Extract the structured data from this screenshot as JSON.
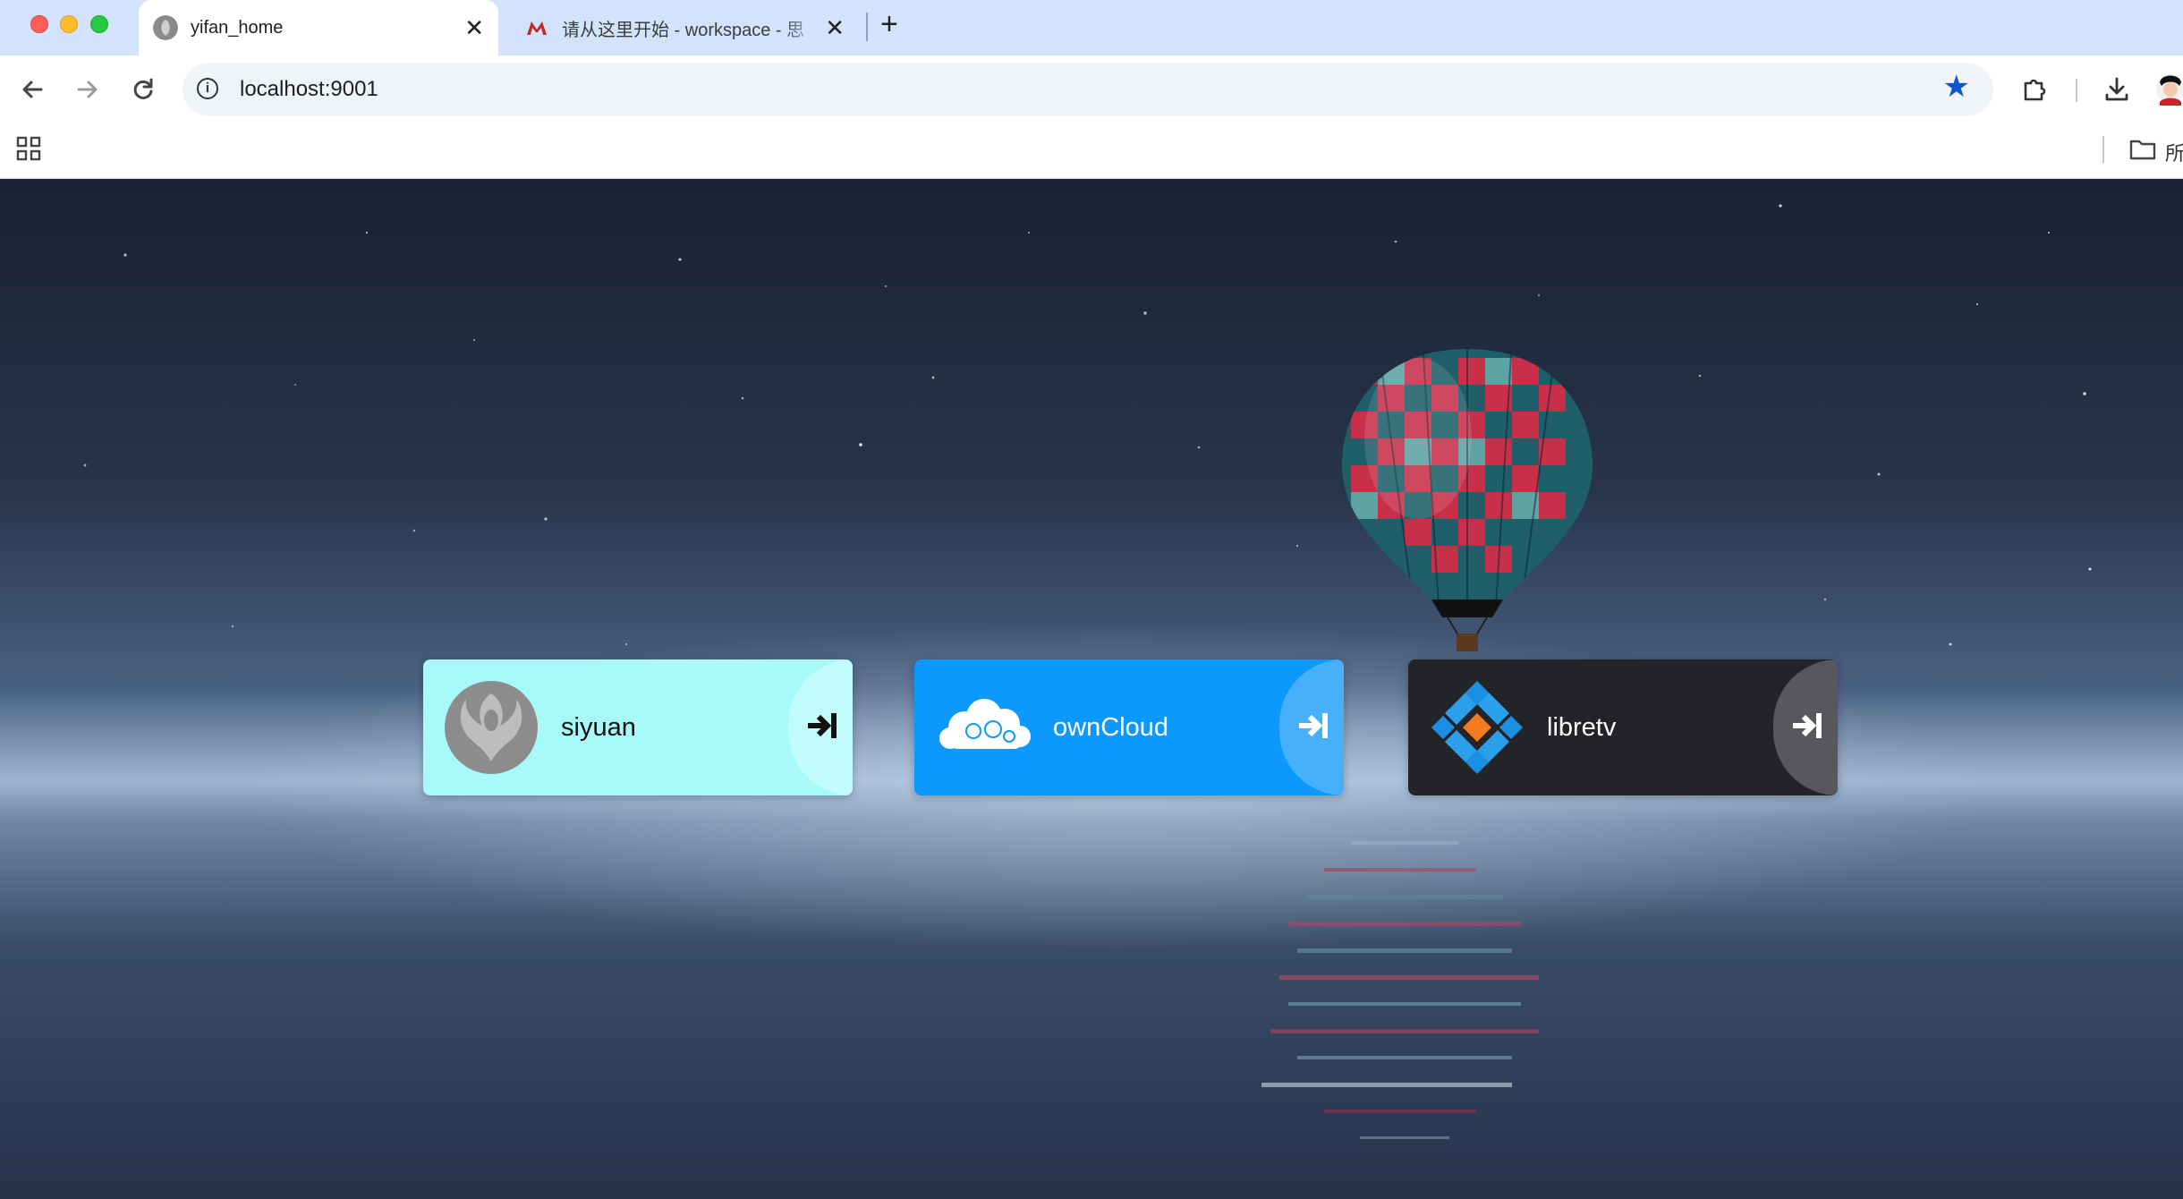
{
  "browser": {
    "tabs": [
      {
        "title": "yifan_home",
        "active": true
      },
      {
        "title": "请从这里开始 - workspace - 思",
        "active": false
      }
    ],
    "url": "localhost:9001",
    "bookmarks_folder_label": "所"
  },
  "apps": [
    {
      "name": "siyuan",
      "color": "#a8fafa"
    },
    {
      "name": "ownCloud",
      "color": "#0d98fc"
    },
    {
      "name": "libretv",
      "color": "#222427"
    }
  ]
}
